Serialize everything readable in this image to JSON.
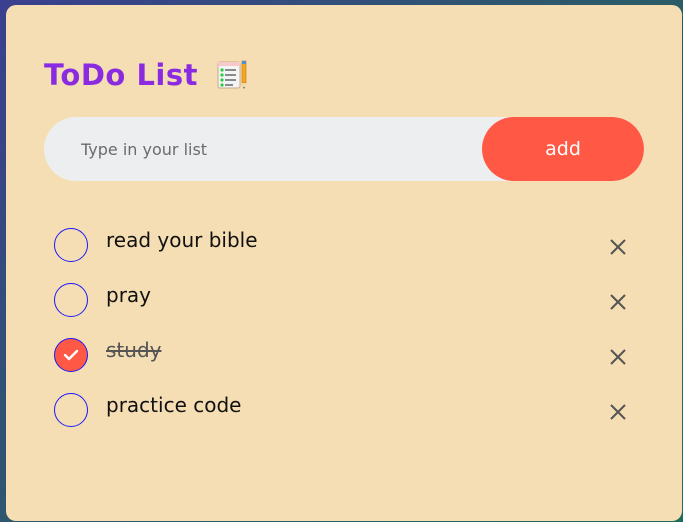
{
  "app": {
    "title": "ToDo List",
    "title_icon": "checklist-notepad-pencil-icon",
    "title_color": "#8a2be2",
    "card_background": "#f5deb3"
  },
  "input": {
    "value": "",
    "placeholder": "Type in your list"
  },
  "add_button": {
    "label": "add",
    "color": "#ff5945"
  },
  "todos": [
    {
      "text": "read your bible",
      "done": false
    },
    {
      "text": "pray",
      "done": false
    },
    {
      "text": "study",
      "done": true
    },
    {
      "text": "practice code",
      "done": false
    }
  ],
  "icons": {
    "checkbox_checked": "check-icon",
    "delete": "close-icon"
  }
}
